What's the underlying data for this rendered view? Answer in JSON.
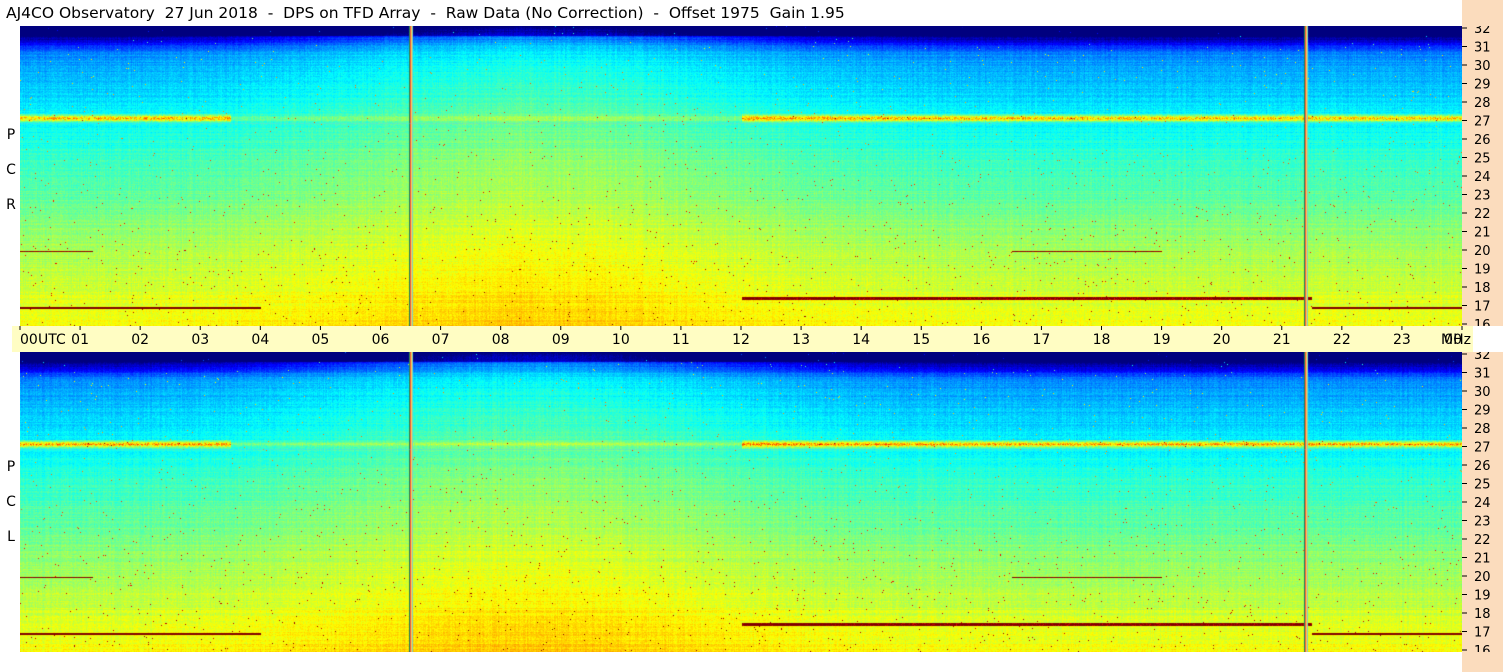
{
  "header": {
    "title": "AJ4CO Observatory  27 Jun 2018  -  DPS on TFD Array  -  Raw Data (No Correction)  -  Offset 1975  Gain 1.95"
  },
  "panels": {
    "top": {
      "label_letters": [
        "R",
        "C",
        "P"
      ]
    },
    "bottom": {
      "label_letters": [
        "L",
        "C",
        "P"
      ]
    }
  },
  "colors": {
    "background": "#ffffff",
    "time_axis_bg": "#fffdc3",
    "freq_axis_bg": "#fbdcbd",
    "colormap": "jet"
  },
  "chart_data": {
    "type": "heatmap",
    "x_axis": {
      "tick_labels": [
        "00",
        "01",
        "02",
        "03",
        "04",
        "05",
        "06",
        "07",
        "08",
        "09",
        "10",
        "11",
        "12",
        "13",
        "14",
        "15",
        "16",
        "17",
        "18",
        "19",
        "20",
        "21",
        "22",
        "23",
        "00"
      ],
      "unit_label": "UTC",
      "range": [
        0,
        24
      ]
    },
    "y_axis": {
      "tick_labels": [
        "16",
        "17",
        "18",
        "19",
        "20",
        "21",
        "22",
        "23",
        "24",
        "25",
        "26",
        "27",
        "28",
        "29",
        "30",
        "31",
        "32"
      ],
      "unit_label": "MHz",
      "range": [
        16,
        32
      ]
    },
    "series": [
      {
        "name": "RCP",
        "description_values": {
          "sharp_vertical_lines_utc": [
            6.5,
            21.4
          ],
          "persistent_bands_mhz": [
            27.1,
            17.5,
            17.0,
            20.0
          ],
          "noise_top_mhz": 31.0
        }
      },
      {
        "name": "LCP",
        "description_values": {
          "sharp_vertical_lines_utc": [
            6.5,
            21.4
          ],
          "persistent_bands_mhz": [
            27.1,
            17.5,
            17.0,
            20.0
          ],
          "noise_top_mhz": 31.0
        }
      }
    ],
    "grid": false
  }
}
